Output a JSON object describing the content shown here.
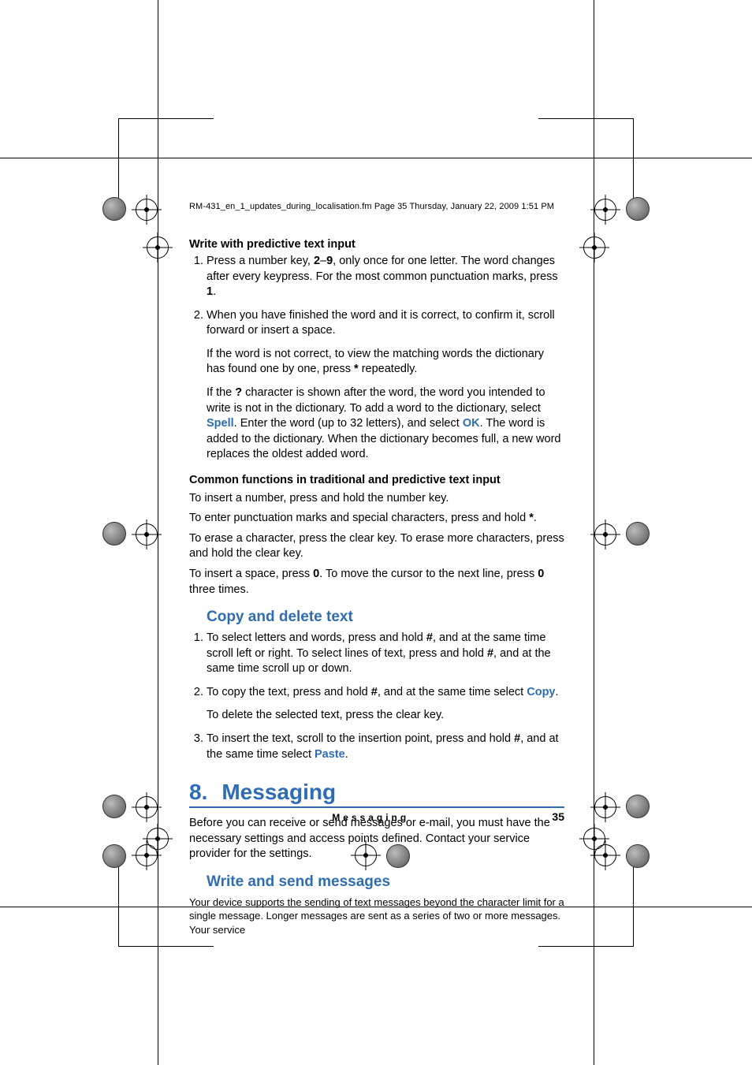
{
  "header": "RM-431_en_1_updates_during_localisation.fm  Page 35  Thursday, January 22, 2009  1:51 PM",
  "s1": {
    "title": "Write with predictive text input",
    "li1_a": "Press a number key, ",
    "li1_b": "2",
    "li1_c": "–",
    "li1_d": "9",
    "li1_e": ", only once for one letter. The word changes after every keypress. For the most common punctuation marks, press ",
    "li1_f": "1",
    "li1_g": ".",
    "li2": "When you have finished the word and it is correct, to confirm it, scroll forward or insert a space.",
    "p2a_a": "If the word is not correct, to view the matching words the dictionary has found one by one, press ",
    "p2a_b": "*",
    "p2a_c": " repeatedly.",
    "p2b_a": "If the ",
    "p2b_b": "?",
    "p2b_c": " character is shown after the word, the word you intended to write is not in the dictionary. To add a word to the dictionary, select ",
    "p2b_spell": "Spell",
    "p2b_d": ". Enter the word (up to 32 letters), and select ",
    "p2b_ok": "OK",
    "p2b_e": ". The word is added to the dictionary. When the dictionary becomes full, a new word replaces the oldest added word."
  },
  "s2": {
    "title": "Common functions in traditional and predictive text input",
    "p1": "To insert a number, press and hold the number key.",
    "p2_a": "To enter punctuation marks and special characters, press and hold ",
    "p2_b": "*",
    "p2_c": ".",
    "p3": "To erase a character, press the clear key. To erase more characters, press and hold the clear key.",
    "p4_a": "To insert a space, press ",
    "p4_b": "0",
    "p4_c": ". To move the cursor to the next line, press ",
    "p4_d": "0",
    "p4_e": " three times."
  },
  "s3": {
    "title": "Copy and delete text",
    "li1_a": "To select letters and words, press and hold ",
    "li1_b": "#",
    "li1_c": ", and at the same time scroll left or right. To select lines of text, press and hold ",
    "li1_d": "#",
    "li1_e": ", and at the same time scroll up or down.",
    "li2_a": "To copy the text, press and hold ",
    "li2_b": "#",
    "li2_c": ", and at the same time select ",
    "li2_copy": "Copy",
    "li2_d": ".",
    "li2_p": "To delete the selected text, press the clear key.",
    "li3_a": "To insert the text, scroll to the insertion point, press and hold ",
    "li3_b": "#",
    "li3_c": ", and at the same time select ",
    "li3_paste": "Paste",
    "li3_d": "."
  },
  "chap": {
    "num": "8.",
    "title": "Messaging",
    "intro": "Before you can receive or send messages or e-mail, you must have the necessary settings and access points defined. Contact your service provider for the settings."
  },
  "s4": {
    "title": "Write and send messages",
    "note": "Your device supports the sending of text messages beyond the character limit for a single message. Longer messages are sent as a series of two or more messages. Your service"
  },
  "footer": {
    "section": "Messaging",
    "page": "35"
  }
}
